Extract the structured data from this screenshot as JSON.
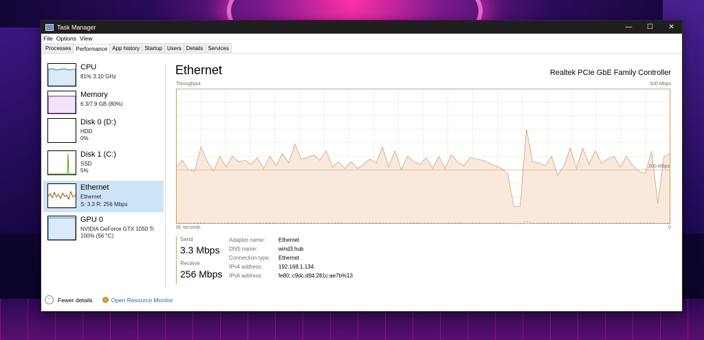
{
  "window": {
    "title": "Task Manager"
  },
  "menu": [
    "File",
    "Options",
    "View"
  ],
  "tabs": [
    "Processes",
    "Performance",
    "App history",
    "Startup",
    "Users",
    "Details",
    "Services"
  ],
  "sidebar": [
    {
      "title": "CPU",
      "lines": [
        "81%  3.10 GHz"
      ],
      "color": "#1a7bc1",
      "active": false
    },
    {
      "title": "Memory",
      "lines": [
        "6.3/7.9 GB (80%)"
      ],
      "color": "#8b1bb5",
      "active": false
    },
    {
      "title": "Disk 0 (D:)",
      "lines": [
        "HDD",
        "0%"
      ],
      "color": "#4da60c",
      "active": false
    },
    {
      "title": "Disk 1 (C:)",
      "lines": [
        "SSD",
        "5%"
      ],
      "color": "#4da60c",
      "active": false
    },
    {
      "title": "Ethernet",
      "lines": [
        "Ethernet",
        "S: 3.3  R: 256 Mbps"
      ],
      "color": "#a74f01",
      "active": true
    },
    {
      "title": "GPU 0",
      "lines": [
        "NVIDIA GeForce GTX 1050 Ti",
        "100%  (56 °C)"
      ],
      "color": "#1a7bc1",
      "active": false
    }
  ],
  "main": {
    "title": "Ethernet",
    "adapter": "Realtek PCIe GbE Family Controller",
    "throughput_label": "Throughput",
    "max_label": "500 Mbps",
    "mid_label": "200 Mbps",
    "time_label": "60 seconds",
    "zero_label": "0"
  },
  "send": {
    "label": "Send",
    "value": "3.3 Mbps"
  },
  "receive": {
    "label": "Receive",
    "value": "256 Mbps"
  },
  "properties": [
    {
      "label": "Adapter name:",
      "value": "Ethernet"
    },
    {
      "label": "DNS name:",
      "value": "wind3.hub"
    },
    {
      "label": "Connection type:",
      "value": "Ethernet"
    },
    {
      "label": "IPv4 address:",
      "value": "192.168.1.134"
    },
    {
      "label": "IPv6 address:",
      "value": "fe80::c9dc:d94:281c:ae7b%13"
    }
  ],
  "footer": {
    "fewer": "Fewer details",
    "monitor": "Open Resource Monitor"
  },
  "chart_data": {
    "type": "area",
    "ylim": [
      0,
      500
    ],
    "series": [
      {
        "values": [
          210,
          235,
          200,
          195,
          285,
          230,
          195,
          250,
          210,
          250,
          230,
          235,
          220,
          245,
          205,
          250,
          215,
          260,
          225,
          295,
          240,
          245,
          255,
          235,
          270,
          210,
          230,
          205,
          230,
          205,
          220,
          240,
          225,
          285,
          210,
          270,
          200,
          250,
          230,
          220,
          245,
          205,
          250,
          205,
          255,
          230,
          215,
          245,
          240,
          235,
          225,
          215,
          205,
          185,
          65,
          65,
          350,
          230,
          225,
          215,
          250,
          180,
          215,
          280,
          205,
          280,
          220,
          270,
          225,
          240,
          250,
          210,
          250,
          215,
          195,
          185,
          270,
          75,
          250,
          260
        ]
      },
      {
        "values": [
          3,
          3,
          3,
          3,
          4,
          3,
          3,
          3,
          3,
          4,
          3,
          3,
          3,
          3,
          3,
          4,
          3,
          3,
          3,
          3,
          4,
          3,
          3,
          3,
          3,
          3,
          4,
          3,
          3,
          3,
          3,
          3,
          4,
          3,
          3,
          3,
          3,
          3,
          4,
          3,
          3,
          3,
          3,
          3,
          3,
          4,
          3,
          3,
          3,
          3,
          3,
          3,
          3,
          3,
          2,
          2,
          10,
          3,
          3,
          3,
          3,
          3,
          3,
          4,
          3,
          3,
          3,
          3,
          3,
          3,
          3,
          3,
          3,
          3,
          3,
          3,
          4,
          2,
          3,
          3
        ]
      }
    ]
  }
}
